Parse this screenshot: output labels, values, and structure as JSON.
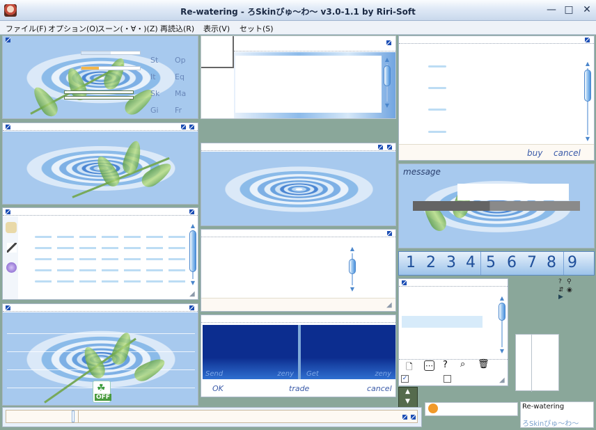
{
  "window": {
    "title": "Re-watering - ろSkinぴゅ～わ～ v3.0-1.1 by Riri-Soft",
    "min_glyph": "—",
    "max_glyph": "□",
    "close_glyph": "✕"
  },
  "menu": [
    {
      "label": "ファイル(F)"
    },
    {
      "label": "オプション(O)"
    },
    {
      "label": "スーン(・∀・)(Z)"
    },
    {
      "label": "再読込(R)"
    },
    {
      "label": "表示(V)"
    },
    {
      "label": "セット(S)"
    }
  ],
  "status_panel": {
    "buttons": [
      {
        "label": "St"
      },
      {
        "label": "Op"
      },
      {
        "label": "It"
      },
      {
        "label": "Eq"
      },
      {
        "label": "Sk"
      },
      {
        "label": "Ma"
      },
      {
        "label": "Gi"
      },
      {
        "label": "Fr"
      }
    ],
    "hp_fill": 0.5,
    "sp_fill": 0.3
  },
  "shop_panel": {
    "buy_label": "buy",
    "cancel_label": "cancel"
  },
  "message_panel": {
    "title": "message"
  },
  "hotkeys": [
    "1",
    "2",
    "3",
    "4",
    "5",
    "6",
    "7",
    "8",
    "9"
  ],
  "trade_panel": {
    "send_label": "Send",
    "send_zeny": "zeny",
    "get_label": "Get",
    "get_zeny": "zeny",
    "ok_label": "OK",
    "trade_label": "trade",
    "cancel_label": "cancel"
  },
  "party_panel": {
    "off_label": "OFF"
  },
  "info_box": {
    "title": "Re-watering",
    "subtitle": "ろSkinぴゅ～わ～"
  },
  "colors": {
    "accent": "#1d4fb5",
    "link": "#3a5aa8",
    "water_dark": "#4b86d3",
    "water_light": "#d6e8f8"
  }
}
